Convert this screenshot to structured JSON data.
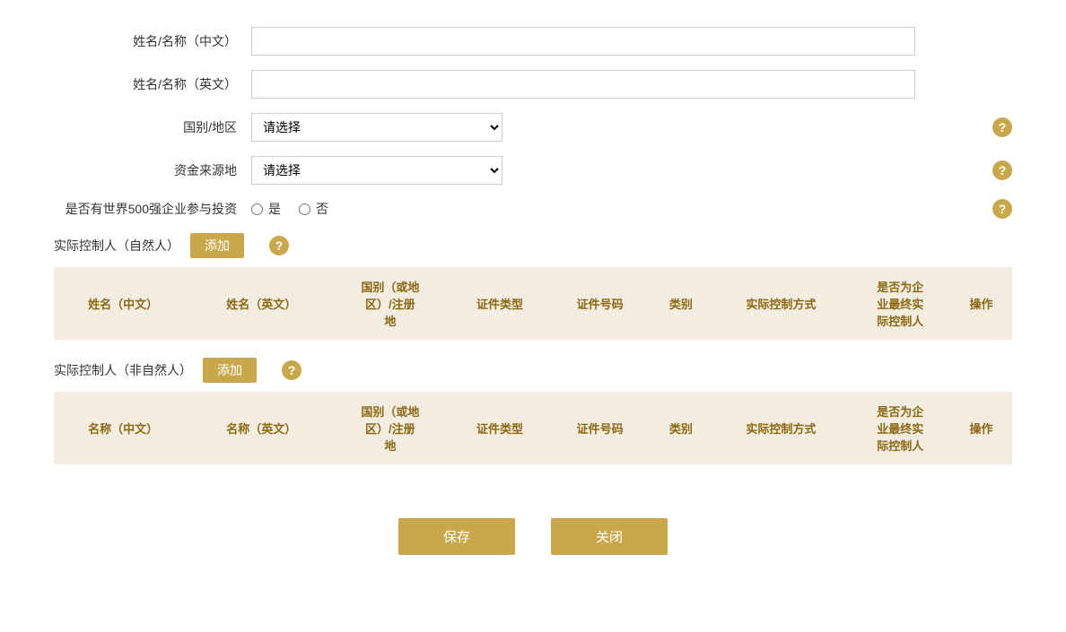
{
  "form": {
    "name_cn_label": "姓名/名称（中文）",
    "name_en_label": "姓名/名称（英文）",
    "country_label": "国别/地区",
    "country_placeholder": "请选择",
    "fund_source_label": "资金来源地",
    "fund_source_placeholder": "请选择",
    "fortune500_label": "是否有世界500强企业参与投资",
    "fortune500_yes": "是",
    "fortune500_no": "否"
  },
  "natural_controller": {
    "title": "实际控制人（自然人）",
    "add_btn": "添加",
    "columns": [
      "姓名（中文）",
      "姓名（英文）",
      "国别（或地区）/注册地",
      "证件类型",
      "证件号码",
      "类别",
      "实际控制方式",
      "是否为企业最终实际控制人",
      "操作"
    ]
  },
  "non_natural_controller": {
    "title": "实际控制人（非自然人）",
    "add_btn": "添加",
    "columns": [
      "名称（中文）",
      "名称（英文）",
      "国别（或地区）/注册地",
      "证件类型",
      "证件号码",
      "类别",
      "实际控制方式",
      "是否为企业最终实际控制人",
      "操作"
    ]
  },
  "buttons": {
    "save": "保存",
    "close": "关闭"
  },
  "help_icon": "?"
}
